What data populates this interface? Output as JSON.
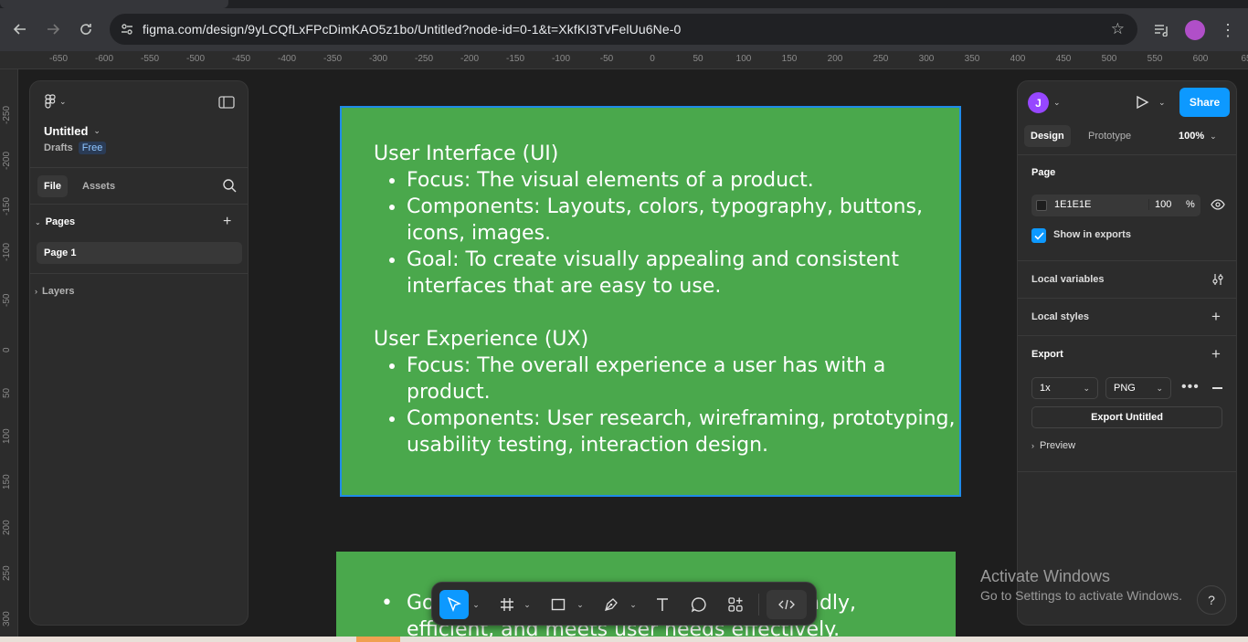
{
  "browser": {
    "url": "figma.com/design/9yLCQfLxFPcDimKAO5z1bo/Untitled?node-id=0-1&t=XkfKI3TvFelUu6Ne-0",
    "icons": [
      "back-arrow-icon",
      "forward-arrow-icon",
      "reload-icon",
      "site-info-icon",
      "bookmark-star-icon",
      "media-control-icon",
      "profile-avatar-icon",
      "kebab-menu-icon"
    ]
  },
  "rulers": {
    "top": [
      "-650",
      "-600",
      "-550",
      "-500",
      "-450",
      "-400",
      "-350",
      "-300",
      "-250",
      "-200",
      "-150",
      "-100",
      "-50",
      "0",
      "50",
      "100",
      "150",
      "200",
      "250",
      "300",
      "350",
      "400",
      "450",
      "500",
      "550",
      "600",
      "65"
    ],
    "left": [
      "-250",
      "-200",
      "-150",
      "-100",
      "-50",
      "0",
      "50",
      "100",
      "150",
      "200",
      "250",
      "300"
    ]
  },
  "left_panel": {
    "file_name": "Untitled",
    "drafts_label": "Drafts",
    "plan_badge": "Free",
    "tabs": [
      "File",
      "Assets"
    ],
    "pages_header": "Pages",
    "pages": [
      "Page 1"
    ],
    "layers_header": "Layers"
  },
  "right_panel": {
    "avatar_initial": "J",
    "share_label": "Share",
    "tabs": [
      "Design",
      "Prototype"
    ],
    "zoom": "100%",
    "page_section": "Page",
    "bg_color_hex": "1E1E1E",
    "bg_opacity": "100",
    "percent_sign": "%",
    "show_in_exports": "Show in exports",
    "local_variables": "Local variables",
    "local_styles": "Local styles",
    "export_section": "Export",
    "export_scale": "1x",
    "export_format": "PNG",
    "export_button": "Export Untitled",
    "preview_label": "Preview"
  },
  "frame1": {
    "heading1": "User Interface (UI)",
    "ui_items": [
      "Focus: The visual elements of a product.",
      "Components: Layouts, colors, typography, buttons, icons, images.",
      "Goal: To create visually appealing and consistent interfaces that are easy to use."
    ],
    "heading2": "User Experience (UX)",
    "ux_items": [
      "Focus: The overall experience a user has with a product.",
      "Components: User research, wireframing, prototyping, usability testing, interaction design."
    ]
  },
  "frame2": {
    "line1_start": "Go",
    "line1_end": "ndly,",
    "line2": "efficient, and meets user needs effectively."
  },
  "watermark": {
    "title": "Activate Windows",
    "subtitle": "Go to Settings to activate Windows."
  },
  "help": "?",
  "colors": {
    "accent": "#0d99ff",
    "frame_green": "#4aa84c",
    "canvas_bg": "#1e1e1e",
    "panel_bg": "#2c2c2c"
  }
}
